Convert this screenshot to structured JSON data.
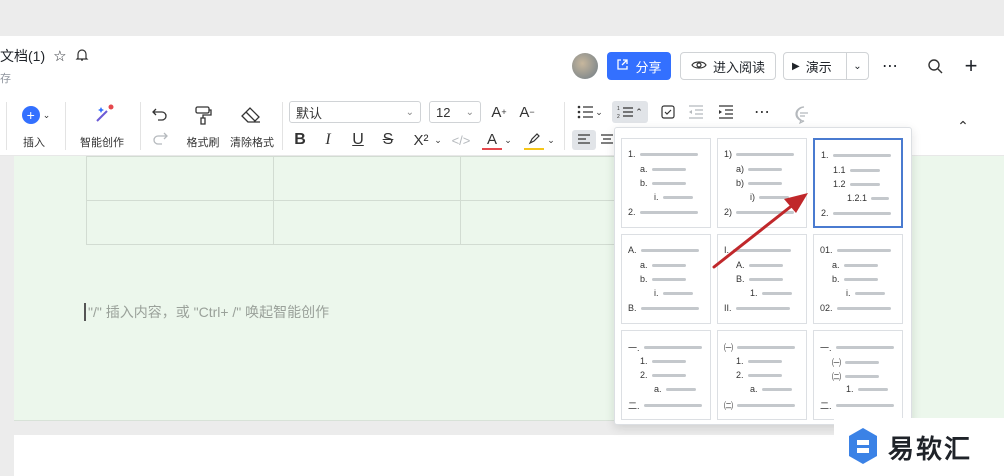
{
  "header": {
    "title": "文档(1)",
    "save_status": "存",
    "share_label": "分享",
    "read_label": "进入阅读",
    "present_label": "演示",
    "more_glyph": "⋯"
  },
  "toolbar": {
    "insert_label": "插入",
    "ai_label": "智能创作",
    "format_brush_label": "格式刷",
    "clear_format_label": "清除格式",
    "font_name": "默认",
    "font_size": "12",
    "superscript": "X²",
    "more_glyph": "⋯"
  },
  "editor": {
    "placeholder": "\"/\" 插入内容，或 \"Ctrl+ /\" 唤起智能创作"
  },
  "list_styles": [
    {
      "id": "decimal-alpha-roman",
      "rows": [
        "1.",
        "a.",
        "b.",
        "i.",
        "2."
      ]
    },
    {
      "id": "paren-alpha-roman",
      "rows": [
        "1)",
        "a)",
        "b)",
        "i)",
        "2)"
      ]
    },
    {
      "id": "multilevel-decimal",
      "rows": [
        "1.",
        "1.1",
        "1.2",
        "1.2.1",
        "2."
      ],
      "selected": true
    },
    {
      "id": "upper-alpha",
      "rows": [
        "A.",
        "a.",
        "b.",
        "i.",
        "B."
      ]
    },
    {
      "id": "roman-alpha",
      "rows": [
        "I.",
        "A.",
        "B.",
        "1.",
        "II."
      ]
    },
    {
      "id": "zero-padded",
      "rows": [
        "01.",
        "a.",
        "b.",
        "i.",
        "02."
      ]
    },
    {
      "id": "chinese-decimal",
      "rows": [
        "一.",
        "1.",
        "2.",
        "a.",
        "二."
      ]
    },
    {
      "id": "chinese-paren-decimal",
      "rows": [
        "㈠",
        "1.",
        "2.",
        "a.",
        "㈡"
      ]
    },
    {
      "id": "chinese-paren-nested",
      "rows": [
        "一.",
        "㈠",
        "㈡",
        "1.",
        "二."
      ]
    }
  ],
  "watermark": {
    "text": "易软汇"
  },
  "colors": {
    "accent": "#3370ff",
    "canvas": "#ecf7ec",
    "arrow": "#c0282b",
    "selected_border": "#4a7bd0"
  }
}
